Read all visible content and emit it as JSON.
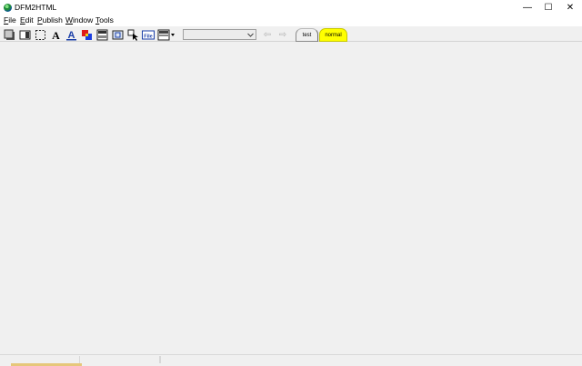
{
  "window": {
    "title": "DFM2HTML",
    "controls": {
      "minimize": "—",
      "maximize": "☐",
      "close": "✕"
    }
  },
  "menubar": {
    "items": [
      {
        "label_u": "F",
        "label_rest": "ile"
      },
      {
        "label_u": "E",
        "label_rest": "dit"
      },
      {
        "label_u": "P",
        "label_rest": "ublish"
      },
      {
        "label_u": "W",
        "label_rest": "indow"
      },
      {
        "label_u": "T",
        "label_rest": "ools"
      }
    ]
  },
  "toolbar": {
    "icons": [
      "frame-object-icon",
      "panel-icon",
      "selection-rectangle-icon",
      "text-label-icon",
      "text-style-icon",
      "color-shapes-icon",
      "form-field-icon",
      "image-box-icon",
      "cursor-object-icon",
      "file-field-icon",
      "layout-menu-icon"
    ],
    "combo_value": "",
    "nav": {
      "back": "⇦",
      "forward": "⇨"
    },
    "tabs": [
      {
        "label": "test",
        "color": "#f0f0f0"
      },
      {
        "label": "normal",
        "color": "#ffff00"
      }
    ]
  },
  "colors": {
    "workspace": "#f0f0f0",
    "active_tab": "#ffff00"
  }
}
